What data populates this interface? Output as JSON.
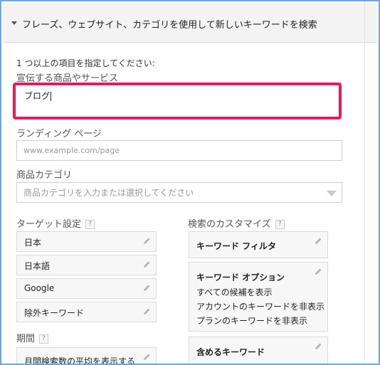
{
  "header": {
    "title": "フレーズ、ウェブサイト、カテゴリを使用して新しいキーワードを検索"
  },
  "form": {
    "instruction": "1 つ以上の項目を指定してください:",
    "product_label": "宣伝する商品やサービス",
    "product_value": "ブログ",
    "landing_label": "ランディング ページ",
    "landing_placeholder": "www.example.com/page",
    "category_label": "商品カテゴリ",
    "category_placeholder": "商品カテゴリを入力または選択してください"
  },
  "targeting": {
    "label": "ターゲット設定",
    "help": "?",
    "items": [
      "日本",
      "日本語",
      "Google",
      "除外キーワード"
    ]
  },
  "period": {
    "label": "期間",
    "help": "?",
    "item": "月間検索数の平均を表示する"
  },
  "customize": {
    "label": "検索のカスタマイズ",
    "help": "?",
    "filter_title": "キーワード フィルタ",
    "options_title": "キーワード オプション",
    "options_lines": [
      "すべての候補を表示",
      "アカウントのキーワードを非表示",
      "プランのキーワードを非表示"
    ],
    "include_title": "含めるキーワード"
  },
  "colors": {
    "highlight": "#e8195f",
    "frame": "#6aa6e8"
  },
  "icons": {
    "edit": "pencil-icon",
    "dropdown": "triangle-down-icon",
    "expand": "caret-down-icon"
  }
}
